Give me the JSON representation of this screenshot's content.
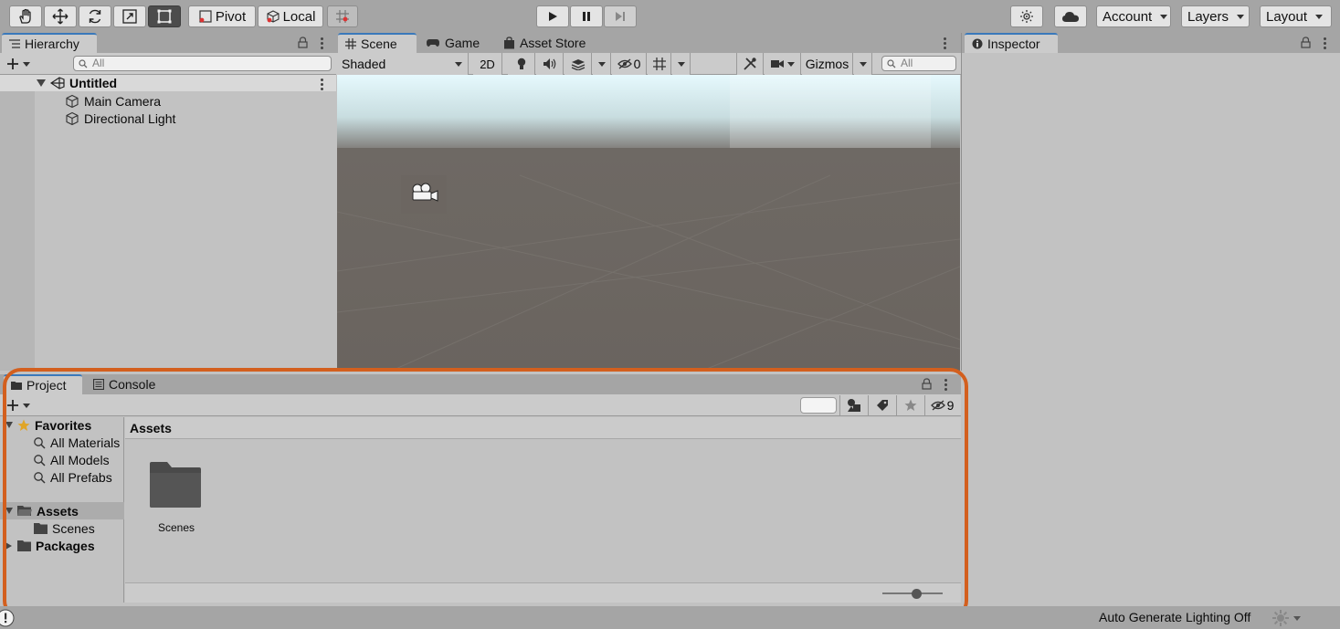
{
  "toolbar": {
    "pivot_label": "Pivot",
    "local_label": "Local",
    "account_label": "Account",
    "layers_label": "Layers",
    "layout_label": "Layout"
  },
  "hierarchy": {
    "tab_label": "Hierarchy",
    "search_placeholder": "All",
    "scene_name": "Untitled",
    "items": [
      {
        "label": "Main Camera",
        "icon": "cube-icon"
      },
      {
        "label": "Directional Light",
        "icon": "cube-icon"
      }
    ]
  },
  "scene_view": {
    "tabs": [
      {
        "label": "Scene",
        "icon": "grid-icon",
        "selected": true
      },
      {
        "label": "Game",
        "icon": "gamepad-icon",
        "selected": false
      },
      {
        "label": "Asset Store",
        "icon": "bag-icon",
        "selected": false
      }
    ],
    "shading_mode": "Shaded",
    "mode_2d_label": "2D",
    "hidden_count": "0",
    "gizmos_label": "Gizmos",
    "search_placeholder": "All"
  },
  "inspector": {
    "tab_label": "Inspector"
  },
  "project": {
    "tabs": [
      {
        "label": "Project",
        "icon": "folder-icon",
        "selected": true
      },
      {
        "label": "Console",
        "icon": "console-icon",
        "selected": false
      }
    ],
    "hidden_count": "9",
    "favorites": {
      "label": "Favorites",
      "items": [
        "All Materials",
        "All Models",
        "All Prefabs"
      ]
    },
    "assets_label": "Assets",
    "assets_children": [
      "Scenes"
    ],
    "packages_label": "Packages",
    "breadcrumb": "Assets",
    "grid_items": [
      {
        "label": "Scenes",
        "icon": "folder-icon"
      }
    ]
  },
  "status_bar": {
    "lighting_text": "Auto Generate Lighting Off"
  },
  "colors": {
    "highlight_outline": "#d35f1e",
    "selected_tab_accent": "#3a79bb",
    "toolbar_bg": "#a5a5a5",
    "panel_bg": "#c2c2c2"
  }
}
